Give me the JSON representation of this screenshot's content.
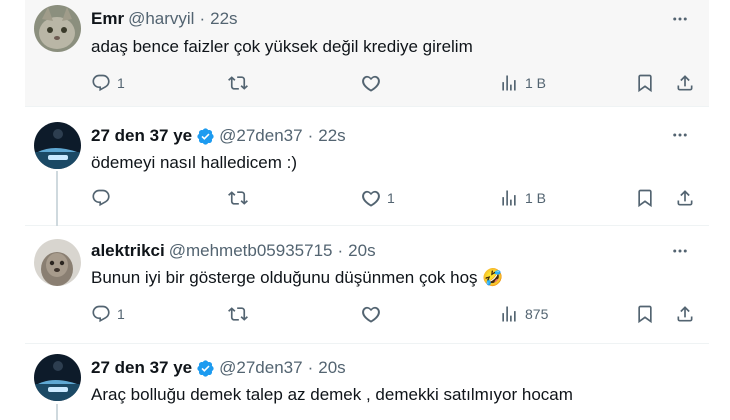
{
  "tweets": [
    {
      "name": "Emr",
      "handle": "@harvyil",
      "time": "22s",
      "text": "adaş bence faizler çok yüksek değil krediye girelim",
      "verified": false,
      "reply_count": "1",
      "retweet_count": "",
      "like_count": "",
      "views": "1 B"
    },
    {
      "name": "27 den 37 ye",
      "handle": "@27den37",
      "time": "22s",
      "text": "ödemeyi nasıl halledicem :)",
      "verified": true,
      "reply_count": "",
      "retweet_count": "",
      "like_count": "1",
      "views": "1 B"
    },
    {
      "name": "alektrikci",
      "handle": "@mehmetb05935715",
      "time": "20s",
      "text": "Bunun iyi bir gösterge olduğunu düşünmen çok hoş",
      "emoji": "🤣",
      "verified": false,
      "reply_count": "1",
      "retweet_count": "",
      "like_count": "",
      "views": "875"
    },
    {
      "name": "27 den 37 ye",
      "handle": "@27den37",
      "time": "20s",
      "text": "Araç bolluğu demek talep az demek , demekki satılmıyor hocam",
      "verified": true
    }
  ],
  "colors": {
    "verified": "#1d9bf0",
    "secondary_text": "#536471",
    "highlight_bg": "#f7f7f7",
    "divider": "#eff3f4"
  },
  "icons": [
    "reply-icon",
    "retweet-icon",
    "like-icon",
    "views-icon",
    "bookmark-icon",
    "share-icon",
    "more-icon",
    "verified-badge-icon"
  ]
}
